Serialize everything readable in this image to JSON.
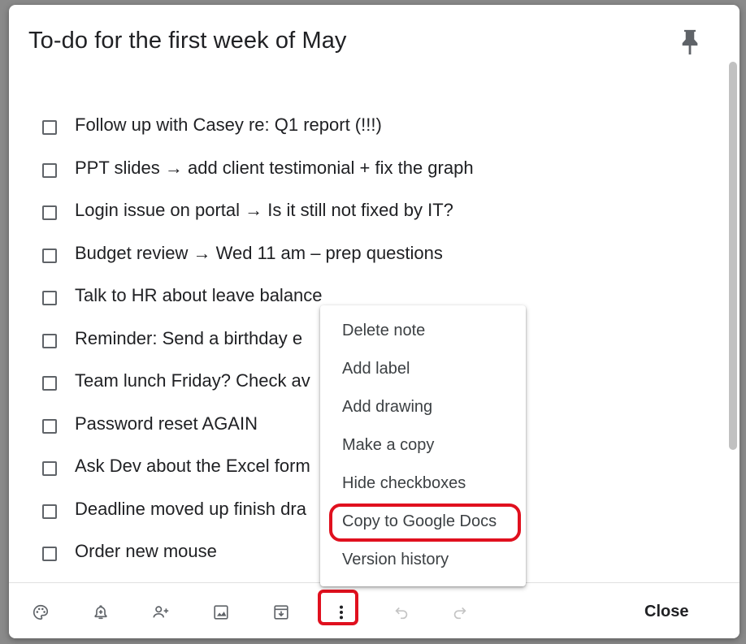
{
  "note": {
    "title": "To-do for the first week of May",
    "items": [
      {
        "label": "Follow up with Casey re: Q1 report (!!!)",
        "checked": false
      },
      {
        "label": "PPT slides → add client testimonial + fix the graph",
        "checked": false
      },
      {
        "label": "Login issue on portal → Is it still not fixed by IT?",
        "checked": false
      },
      {
        "label": "Budget review → Wed 11 am – prep questions",
        "checked": false
      },
      {
        "label": "Talk to HR about leave balance",
        "checked": false
      },
      {
        "label": "Reminder: Send a birthday e",
        "checked": false
      },
      {
        "label": "Team lunch Friday? Check av",
        "checked": false
      },
      {
        "label": "Password reset AGAIN",
        "checked": false
      },
      {
        "label": "Ask Dev about the Excel form",
        "checked": false
      },
      {
        "label": "Deadline moved up finish dra",
        "checked": false
      },
      {
        "label": "Order new mouse",
        "checked": false
      }
    ]
  },
  "menu": {
    "items": [
      {
        "label": "Delete note"
      },
      {
        "label": "Add label"
      },
      {
        "label": "Add drawing"
      },
      {
        "label": "Make a copy"
      },
      {
        "label": "Hide checkboxes"
      },
      {
        "label": "Copy to Google Docs"
      },
      {
        "label": "Version history"
      }
    ]
  },
  "toolbar": {
    "icons": [
      "palette-icon",
      "add-reminder-icon",
      "collaborator-icon",
      "image-icon",
      "archive-icon",
      "more-vertical-icon",
      "undo-icon",
      "redo-icon"
    ],
    "close_label": "Close"
  },
  "colors": {
    "highlight": "#e0101e",
    "text": "#202124",
    "icon": "#5f6368"
  }
}
